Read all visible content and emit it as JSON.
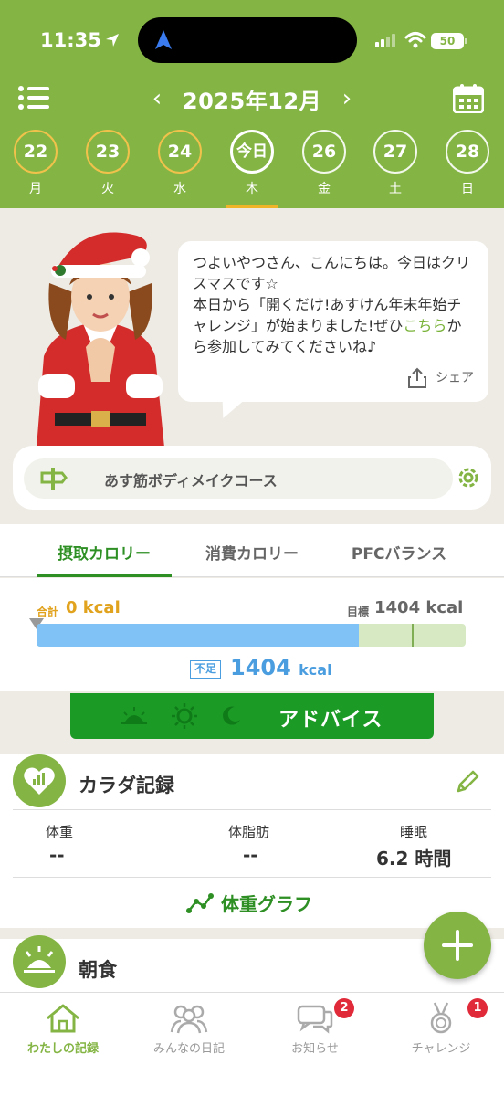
{
  "status_bar": {
    "time": "11:35",
    "battery": "50"
  },
  "header": {
    "month_label": "2025年12月",
    "prev": "‹",
    "next": "›"
  },
  "days": [
    {
      "date": "22",
      "weekday": "月"
    },
    {
      "date": "23",
      "weekday": "火"
    },
    {
      "date": "24",
      "weekday": "水"
    },
    {
      "date": "今日",
      "weekday": "木"
    },
    {
      "date": "26",
      "weekday": "金"
    },
    {
      "date": "27",
      "weekday": "土"
    },
    {
      "date": "28",
      "weekday": "日"
    }
  ],
  "greeting": {
    "line1": "つよいやつさん、こんにちは。今日はクリスマスです☆",
    "line2_pre": "本日から「開くだけ!あすけん年末年始チャレンジ」が始まりました!ぜひ",
    "link": "こちら",
    "line2_post": "から参加してみてくださいね♪",
    "share": "シェア"
  },
  "course": {
    "name": "あす筋ボディメイクコース"
  },
  "calorie_tabs": [
    "摂取カロリー",
    "消費カロリー",
    "PFCバランス"
  ],
  "calorie": {
    "total_label": "合計",
    "total_value": "0 kcal",
    "goal_label": "目標",
    "goal_value": "1404 kcal",
    "progress_fraction": 0.75,
    "short_label": "不足",
    "short_value": "1404",
    "short_unit": "kcal"
  },
  "advice": {
    "label": "アドバイス"
  },
  "body_record": {
    "title": "カラダ記録",
    "metrics": [
      {
        "label": "体重",
        "value": "--"
      },
      {
        "label": "体脂肪",
        "value": "--"
      },
      {
        "label": "睡眠",
        "value": "6.2 時間"
      }
    ],
    "graph_link": "体重グラフ"
  },
  "meal": {
    "title": "朝食"
  },
  "tabbar": [
    {
      "label": "わたしの記録",
      "badge": ""
    },
    {
      "label": "みんなの日記",
      "badge": ""
    },
    {
      "label": "お知らせ",
      "badge": "2"
    },
    {
      "label": "チャレンジ",
      "badge": "1"
    }
  ],
  "colors": {
    "brand_green": "#84b544",
    "accent_green": "#2e8f24",
    "advice_green": "#1c9a26",
    "gold": "#f0c24b",
    "blue": "#4a9ee0",
    "badge_red": "#e02a3a"
  }
}
